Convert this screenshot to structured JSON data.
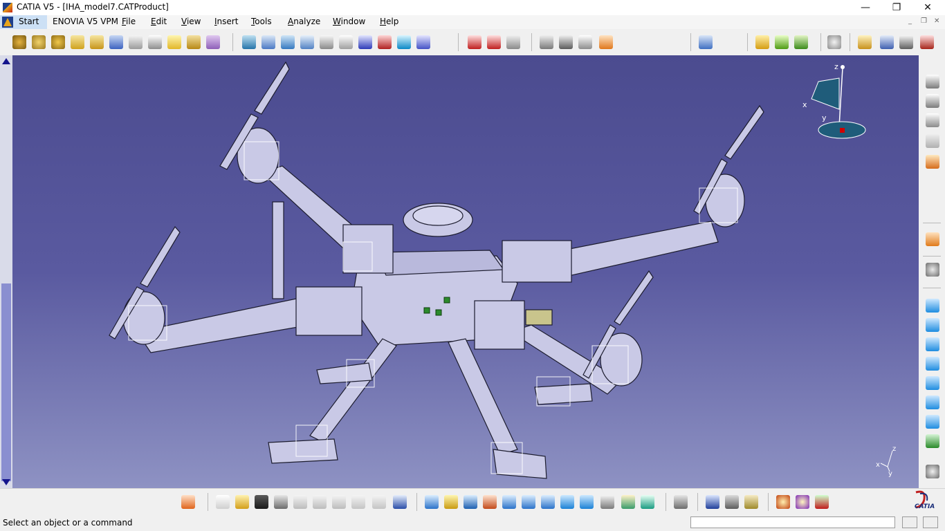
{
  "window": {
    "title": "CATIA V5 - [IHA_model7.CATProduct]",
    "minimize": "—",
    "restore": "❐",
    "close": "✕"
  },
  "menu": {
    "start": "Start",
    "enovia": "ENOVIA V5 VPM",
    "items": [
      {
        "first": "F",
        "rest": "ile"
      },
      {
        "first": "E",
        "rest": "dit"
      },
      {
        "first": "V",
        "rest": "iew"
      },
      {
        "first": "I",
        "rest": "nsert"
      },
      {
        "first": "T",
        "rest": "ools"
      },
      {
        "first": "A",
        "rest": "nalyze"
      },
      {
        "first": "W",
        "rest": "indow"
      },
      {
        "first": "H",
        "rest": "elp"
      }
    ],
    "mdi_min": "_",
    "mdi_restore": "❐",
    "mdi_close": "✕"
  },
  "compass": {
    "x": "x",
    "y": "y",
    "z": "z"
  },
  "axis_triad": {
    "x": "x",
    "y": "y",
    "z": "z"
  },
  "status": {
    "message": "Select an object or a command",
    "command_value": ""
  },
  "brand": {
    "logo_text": "CATIA"
  },
  "colors": {
    "viewport_top": "#4b4b8f",
    "viewport_bottom": "#8e92c3",
    "part_fill": "#c9c9e6",
    "part_stroke": "#1c1c2e",
    "selection": "#ffffff"
  }
}
